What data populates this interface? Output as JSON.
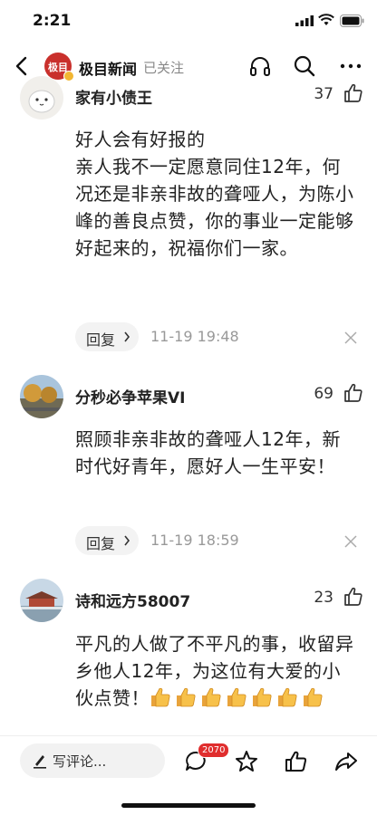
{
  "status_bar": {
    "time": "2:21"
  },
  "header": {
    "source_name": "极目新闻",
    "follow_status": "已关注",
    "logo_text": "极目"
  },
  "comments": [
    {
      "user": "家有小债王",
      "likes": "37",
      "text": "好人会有好报的\n亲人我不一定愿意同住12年，何况还是非亲非故的聋哑人，为陈小峰的善良点赞，你的事业一定能够好起来的，祝福你们一家。",
      "reply_label": "回复",
      "time": "11-19 19:48"
    },
    {
      "user": "分秒必争苹果VI",
      "likes": "69",
      "text": "照顾非亲非故的聋哑人12年，新时代好青年，愿好人一生平安！",
      "reply_label": "回复",
      "time": "11-19 18:59"
    },
    {
      "user": "诗和远方58007",
      "likes": "23",
      "text": "平凡的人做了不平凡的事，收留异乡他人12年，为这位有大爱的小伙点赞！",
      "emoji_count": 7
    }
  ],
  "bottom_bar": {
    "write_placeholder": "写评论...",
    "comment_count": "2070"
  },
  "icons": [
    "back-icon",
    "headphones-icon",
    "search-icon",
    "more-icon",
    "thumb-up-icon",
    "close-icon",
    "pen-icon",
    "comment-icon",
    "star-icon",
    "share-icon"
  ]
}
